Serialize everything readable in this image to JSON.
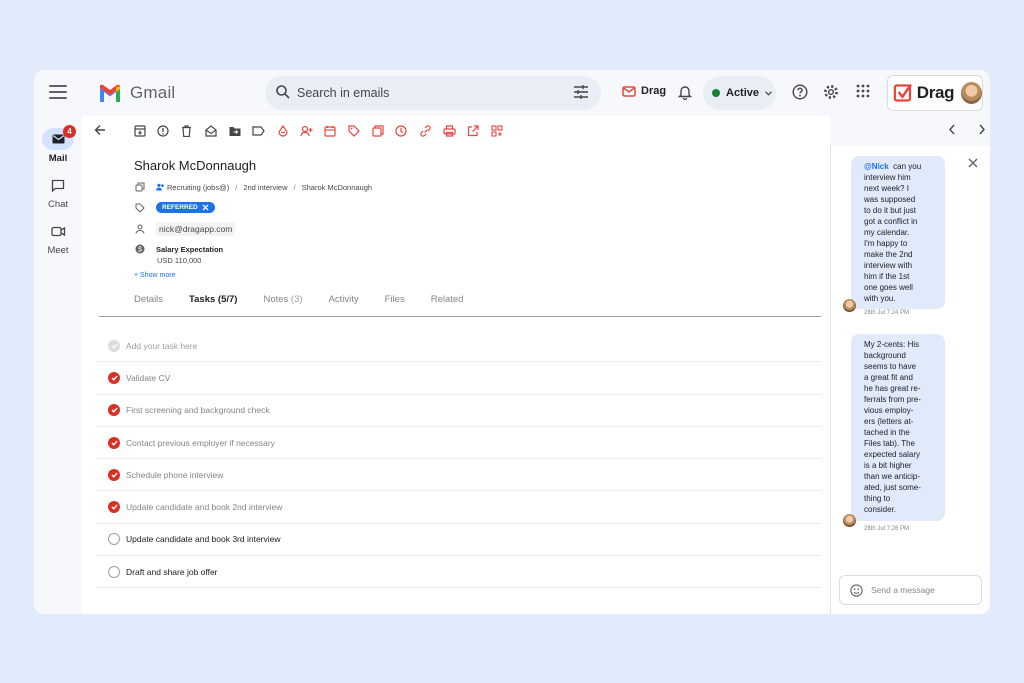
{
  "app": {
    "name": "Gmail"
  },
  "search": {
    "placeholder": "Search in emails"
  },
  "header": {
    "drag_label": "Drag",
    "status_label": "Active",
    "brand_label": "Drag"
  },
  "rail": [
    {
      "label": "Mail",
      "badge": "4"
    },
    {
      "label": "Chat"
    },
    {
      "label": "Meet"
    }
  ],
  "email": {
    "subject": "Sharok McDonnaugh",
    "breadcrumb": [
      "Recruiting (jobs@)",
      "2nd interview",
      "Sharok McDonnaugh"
    ],
    "breadcrumb_sep": "/",
    "tag": "REFERRED",
    "contact": "nick@dragapp.com",
    "salary_label": "Salary Expectation",
    "salary_value": "USD 110,000",
    "show_more": "+ Show more"
  },
  "tabs": [
    {
      "label": "Details"
    },
    {
      "label": "Tasks (5/7)"
    },
    {
      "label": "Notes",
      "count": "(3)"
    },
    {
      "label": "Activity"
    },
    {
      "label": "Files"
    },
    {
      "label": "Related"
    }
  ],
  "tasks": {
    "add_placeholder": "Add your task here",
    "items": [
      {
        "label": "Validate CV",
        "done": true
      },
      {
        "label": "First screening and background check",
        "done": true
      },
      {
        "label": "Contact previous employer if necessary",
        "done": true
      },
      {
        "label": "Schedule phone interview",
        "done": true
      },
      {
        "label": "Update candidate and book 2nd interview",
        "done": true
      },
      {
        "label": "Update candidate and book 3rd interview",
        "done": false
      },
      {
        "label": "Draft and share job offer",
        "done": false
      }
    ]
  },
  "chat": {
    "messages": [
      {
        "mention": "@Nick",
        "lines": [
          "can you",
          "interview him",
          "next week? I",
          "was supposed",
          "to do it but just",
          "got a conflict in",
          "my calendar.",
          "I'm happy to",
          "make the 2nd",
          "interview with",
          "him if the 1st",
          "one goes well",
          "with you."
        ],
        "time": "28th Jul 7:24 PM"
      },
      {
        "lines": [
          "My 2-cents: His",
          "background",
          "seems to have",
          "a great fit and",
          "he has great re-",
          "ferrals from pre-",
          "vious employ-",
          "ers (letters at-",
          "tached in the",
          "Files tab). The",
          "expected salary",
          "is a bit higher",
          "than we anticip-",
          "ated, just some-",
          "thing to",
          "consider."
        ],
        "time": "28th Jul 7:26 PM"
      }
    ],
    "input_placeholder": "Send a message"
  },
  "colors": {
    "accent": "#1a73e8",
    "done": "#d93025",
    "drag_red": "#e8453c",
    "active_green": "#188038"
  }
}
